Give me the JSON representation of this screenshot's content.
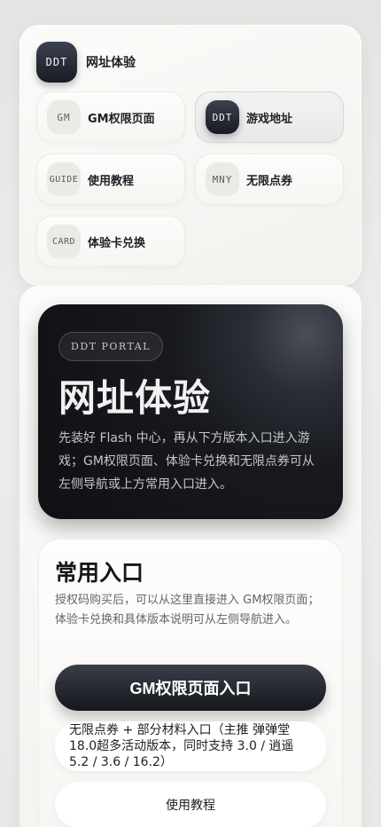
{
  "nav": {
    "brand": {
      "badge": "DDT",
      "label": "网址体验"
    },
    "items": [
      {
        "badge": "GM",
        "label": "GM权限页面",
        "active": false
      },
      {
        "badge": "DDT",
        "label": "游戏地址",
        "active": true
      },
      {
        "badge": "GUIDE",
        "label": "使用教程",
        "active": false
      },
      {
        "badge": "MNY",
        "label": "无限点券",
        "active": false
      },
      {
        "badge": "CARD",
        "label": "体验卡兑换",
        "active": false
      }
    ]
  },
  "hero": {
    "chip": "DDT PORTAL",
    "title": "网址体验",
    "description": "先装好 Flash 中心，再从下方版本入口进入游戏；GM权限页面、体验卡兑换和无限点券可从左侧导航或上方常用入口进入。"
  },
  "entry": {
    "title": "常用入口",
    "description": "授权码购买后，可以从这里直接进入 GM权限页面；体验卡兑换和具体版本说明可从左侧导航进入。",
    "primary_button": "GM权限页面入口",
    "points_button": "无限点券 + 部分材料入口（主推 弹弹堂18.0超多活动版本，同时支持 3.0 / 逍遥5.2 / 3.6 / 16.2）",
    "tutorial_button": "使用教程"
  },
  "colors": {
    "accent_dark": "#17191e",
    "card_bg": "#f7f6f3",
    "page_bg": "#e8e8e6"
  }
}
